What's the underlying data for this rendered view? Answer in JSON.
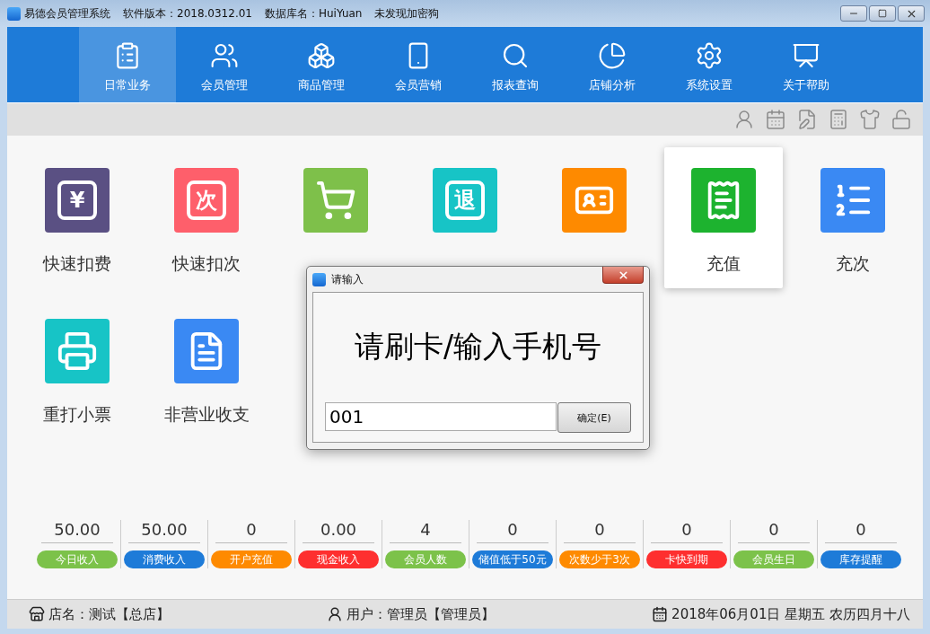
{
  "window": {
    "title_parts": [
      "易德会员管理系统",
      "软件版本：2018.0312.01",
      "数据库名：HuiYuan",
      "未发现加密狗"
    ]
  },
  "nav": [
    {
      "label": "日常业务",
      "selected": true
    },
    {
      "label": "会员管理",
      "selected": false
    },
    {
      "label": "商品管理",
      "selected": false
    },
    {
      "label": "会员营销",
      "selected": false
    },
    {
      "label": "报表查询",
      "selected": false
    },
    {
      "label": "店铺分析",
      "selected": false
    },
    {
      "label": "系统设置",
      "selected": false
    },
    {
      "label": "关于帮助",
      "selected": false
    }
  ],
  "tiles": [
    {
      "label": "快速扣费",
      "color": "#5a5083",
      "glyph": "¥",
      "selected": false
    },
    {
      "label": "快速扣次",
      "color": "#fe5f6b",
      "glyph": "次",
      "selected": false
    },
    {
      "color": "#7ec04a",
      "selected": false
    },
    {
      "color": "#17c4c6",
      "glyph": "退",
      "selected": false
    },
    {
      "color": "#fe8a00",
      "selected": false
    },
    {
      "label": "充值",
      "color": "#1db32f",
      "selected": true
    },
    {
      "label": "充次",
      "color": "#3a89f3",
      "selected": false
    },
    {
      "label": "重打小票",
      "color": "#17c4c6",
      "selected": false
    },
    {
      "label": "非营业收支",
      "color": "#3a89f3",
      "selected": false
    }
  ],
  "stats": [
    {
      "value": "50.00",
      "label": "今日收入",
      "color": "#7cc24a"
    },
    {
      "value": "50.00",
      "label": "消费收入",
      "color": "#1e7bd8"
    },
    {
      "value": "0",
      "label": "开户充值",
      "color": "#fe8a00"
    },
    {
      "value": "0.00",
      "label": "现金收入",
      "color": "#fe2f2f"
    },
    {
      "value": "4",
      "label": "会员人数",
      "color": "#7cc24a"
    },
    {
      "value": "0",
      "label": "储值低于50元",
      "color": "#1e7bd8"
    },
    {
      "value": "0",
      "label": "次数少于3次",
      "color": "#fe8a00"
    },
    {
      "value": "0",
      "label": "卡快到期",
      "color": "#fe2f2f"
    },
    {
      "value": "0",
      "label": "会员生日",
      "color": "#7cc24a"
    },
    {
      "value": "0",
      "label": "库存提醒",
      "color": "#1e7bd8"
    }
  ],
  "status_bar": {
    "shop": "店名：测试【总店】",
    "user": "用户：管理员【管理员】",
    "date": "2018年06月01日 星期五 农历四月十八"
  },
  "dialog": {
    "title": "请输入",
    "prompt": "请刷卡/输入手机号",
    "value": "001",
    "button": "确定(E)"
  }
}
